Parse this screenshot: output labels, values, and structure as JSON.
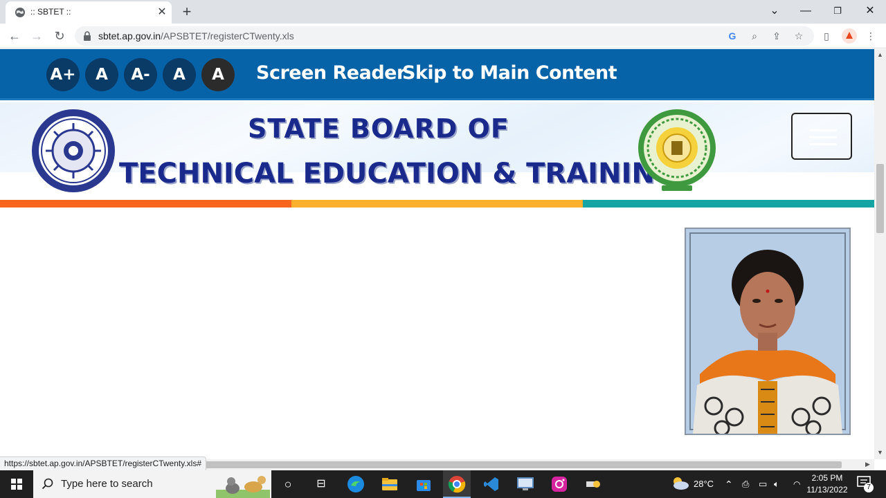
{
  "browser": {
    "tab_title": ":: SBTET ::",
    "url_host": "sbtet.ap.gov.in",
    "url_path": "/APSBTET/registerCTwenty.xls",
    "status_url": "https://sbtet.ap.gov.in/APSBTET/registerCTwenty.xls#"
  },
  "accessibility": {
    "font_buttons": [
      "A+",
      "A",
      "A-",
      "A",
      "A"
    ],
    "screen_reader": "Screen Reader",
    "skip_main": "Skip to Main Content"
  },
  "banner": {
    "line1": "STATE BOARD OF",
    "line2": "TECHNICAL EDUCATION & TRAINING",
    "stripe_colors": [
      "#f7661c",
      "#fbb02d",
      "#14a4a4"
    ]
  },
  "taskbar": {
    "search_placeholder": "Type here to search",
    "temperature": "28°C",
    "time": "2:05 PM",
    "date": "11/13/2022",
    "notification_count": "7"
  }
}
